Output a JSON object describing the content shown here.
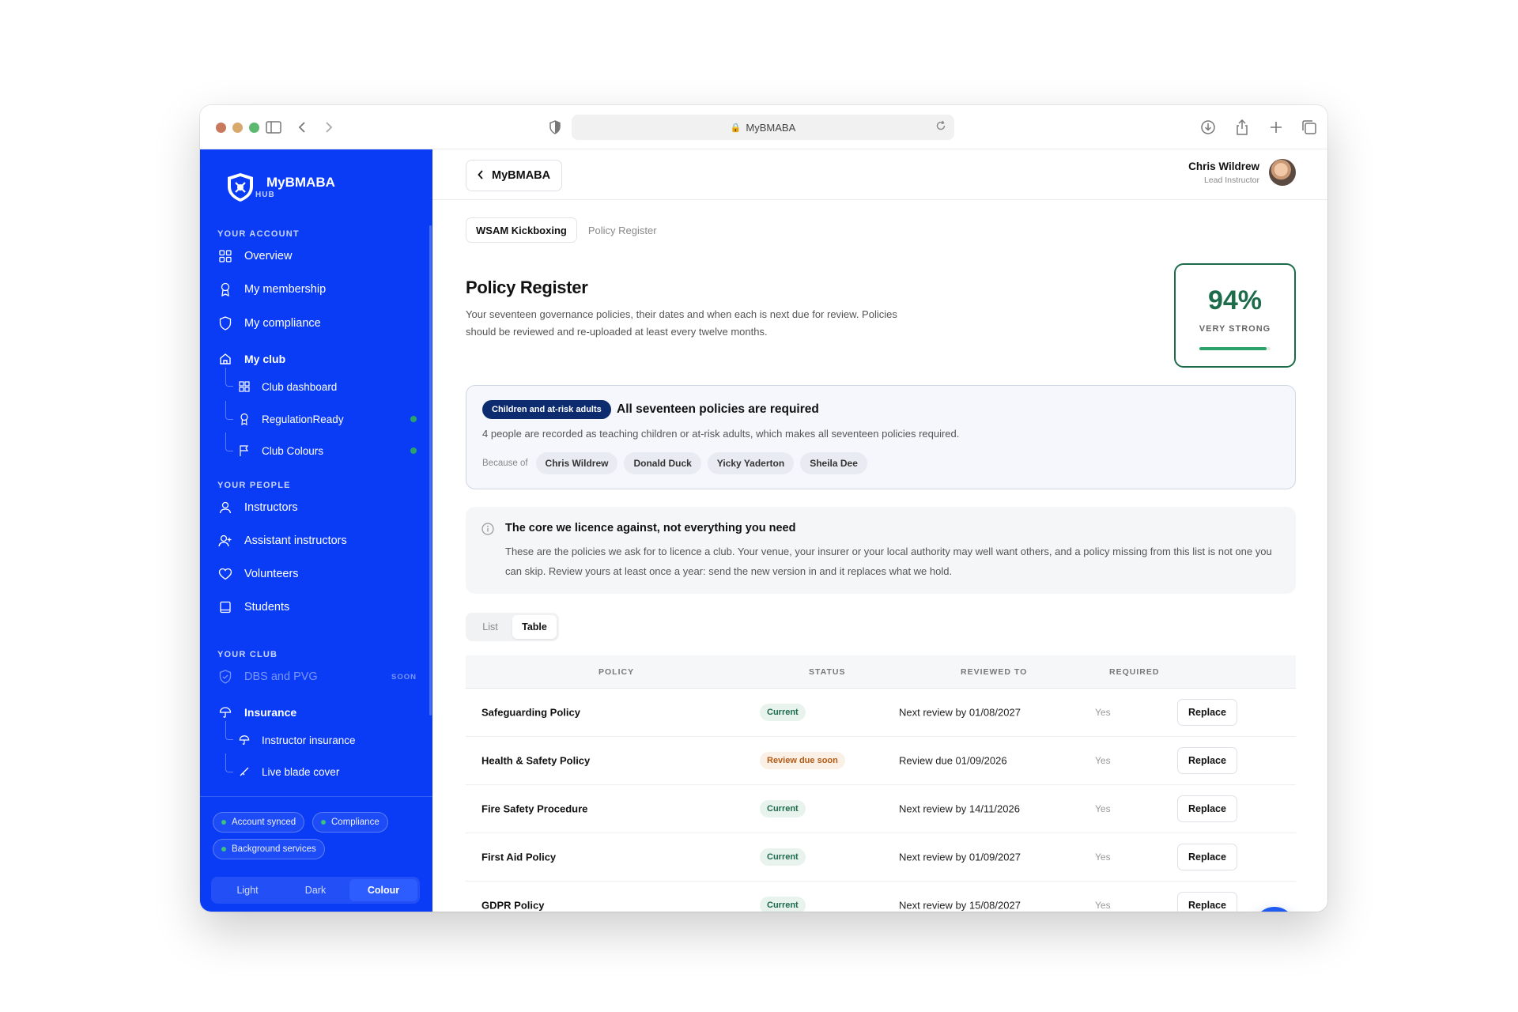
{
  "browser": {
    "url": "MyBMABA"
  },
  "brand": {
    "name": "MyBMABA",
    "sub": "HUB"
  },
  "sidebar": {
    "sections": {
      "account": "YOUR ACCOUNT",
      "people": "YOUR PEOPLE",
      "club": "YOUR CLUB"
    },
    "account": [
      "Overview",
      "My membership",
      "My compliance"
    ],
    "my_club": "My club",
    "my_club_items": [
      "Club dashboard",
      "RegulationReady",
      "Club Colours"
    ],
    "people": [
      "Instructors",
      "Assistant instructors",
      "Volunteers",
      "Students"
    ],
    "dbs": "DBS and PVG",
    "soon": "SOON",
    "insurance": "Insurance",
    "insurance_items": [
      "Instructor insurance",
      "Live blade cover"
    ],
    "status": [
      "Account synced",
      "Compliance",
      "Background services"
    ],
    "themes": [
      "Light",
      "Dark",
      "Colour"
    ]
  },
  "topbar": {
    "back_label": "MyBMABA",
    "user_name": "Chris Wildrew",
    "user_role": "Lead Instructor"
  },
  "breadcrumb": [
    "WSAM Kickboxing",
    "Policy Register"
  ],
  "page": {
    "title": "Policy Register",
    "description": "Your seventeen governance policies, their dates and when each is next due for review. Policies should be reviewed and re-uploaded at least every twelve months."
  },
  "score": {
    "value": "94%",
    "label": "VERY STRONG",
    "fraction": 0.94,
    "color": "#1c6b4a"
  },
  "requirement": {
    "badge": "Children and at-risk adults",
    "title": "All seventeen policies are required",
    "description": "4 people are recorded as teaching children or at-risk adults, which makes all seventeen policies required.",
    "because_label": "Because of",
    "people": [
      "Chris Wildrew",
      "Donald Duck",
      "Yicky Yaderton",
      "Sheila Dee"
    ]
  },
  "info": {
    "title": "The core we licence against, not everything you need",
    "body": "These are the policies we ask for to licence a club. Your venue, your insurer or your local authority may well want others, and a policy missing from this list is not one you can skip. Review yours at least once a year: send the new version in and it replaces what we hold."
  },
  "view_toggle": [
    "List",
    "Table"
  ],
  "table": {
    "headers": [
      "POLICY",
      "STATUS",
      "REVIEWED TO",
      "REQUIRED"
    ],
    "rows": [
      {
        "policy": "Safeguarding Policy",
        "status": "Current",
        "review": "Next review by 01/08/2027",
        "required": "Yes",
        "action": "Replace"
      },
      {
        "policy": "Health & Safety Policy",
        "status": "Review due soon",
        "review": "Review due 01/09/2026",
        "required": "Yes",
        "action": "Replace"
      },
      {
        "policy": "Fire Safety Procedure",
        "status": "Current",
        "review": "Next review by 14/11/2026",
        "required": "Yes",
        "action": "Replace"
      },
      {
        "policy": "First Aid Policy",
        "status": "Current",
        "review": "Next review by 01/09/2027",
        "required": "Yes",
        "action": "Replace"
      },
      {
        "policy": "GDPR Policy",
        "status": "Current",
        "review": "Next review by 15/08/2027",
        "required": "Yes",
        "action": "Replace"
      }
    ]
  },
  "colors": {
    "sidebar": "#0a3cf5",
    "accent_green": "#2aa36b",
    "warning": "#b35a14"
  }
}
